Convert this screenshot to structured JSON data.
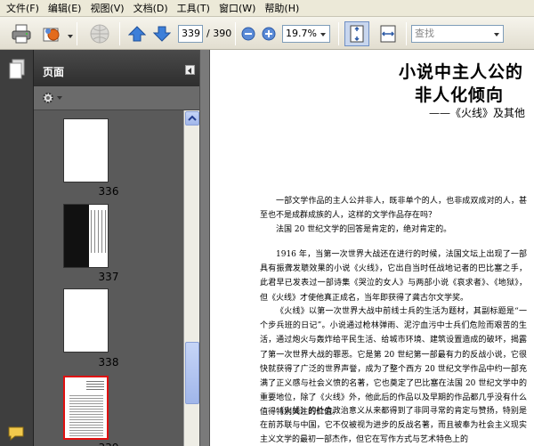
{
  "menu": {
    "items": [
      "文件(F)",
      "编辑(E)",
      "视图(V)",
      "文档(D)",
      "工具(T)",
      "窗口(W)",
      "帮助(H)"
    ]
  },
  "toolbar": {
    "current_page": "339",
    "total_pages": "/ 390",
    "zoom": "19.7%",
    "search_placeholder": "查找",
    "icons": [
      "printer-icon",
      "email-icon",
      "globe-icon",
      "prev-page-icon",
      "next-page-icon",
      "zoom-out-icon",
      "zoom-in-icon",
      "fit-page-icon",
      "fit-width-icon"
    ]
  },
  "panel": {
    "title": "页面",
    "options_icon": "gear-icon",
    "thumbnails": [
      {
        "label": "336",
        "style": "blank"
      },
      {
        "label": "337",
        "style": "dark"
      },
      {
        "label": "338",
        "style": "blank"
      },
      {
        "label": "339",
        "style": "text",
        "selected": true
      }
    ]
  },
  "document": {
    "title_line1": "小说中主人公的",
    "title_line2": "非人化倾向",
    "subtitle": "——《火线》及其他",
    "paragraphs": [
      "一部文学作品的主人公并非人，既非单个的人，也非成双成对的人，甚至也不是成群成族的人，这样的文学作品存在吗？",
      "法国 20 世纪文学的回答是肯定的，绝对肯定的。",
      "1916 年，当第一次世界大战还在进行的时候，法国文坛上出现了一部具有振聋发聩效果的小说《火线》，它出自当时任战地记者的巴比塞之手，此君早已发表过一部诗集《哭泣的女人》与两部小说《哀求者》、《地狱》，但《火线》才使他真正成名，当年即获得了龚古尔文学奖。",
      "《火线》以第一次世界大战中前线士兵的生活为题材，其副标题是“一个步兵班的日记”。小说通过枪林弹雨、泥泞血污中士兵们危险而艰苦的生活，通过炮火与轰炸给平民生活、给城市环境、建筑设置造成的破坏，揭露了第一次世界大战的罪恶。它是第 20 世纪第一部最有力的反战小说，它很快就获得了广泛的世界声誉，成为了整个西方 20 世纪文学作品中约一部充满了正义感与社会义愤的名著，它也奠定了巴比塞在法国 20 世纪文学中的重要地位，除了《火线》外，他此后的作品以及早期的作品都几乎没有什么值得特别关注的价值。",
      "《火线》的社会政治意义从来都得到了非同寻常的肯定与赞扬，特别是在前苏联与中国，它不仅被视为进步的反战名著，而且被奉为社会主义现实主义文学的最初一部杰作，但它在写作方式与艺术特色上的"
    ]
  }
}
